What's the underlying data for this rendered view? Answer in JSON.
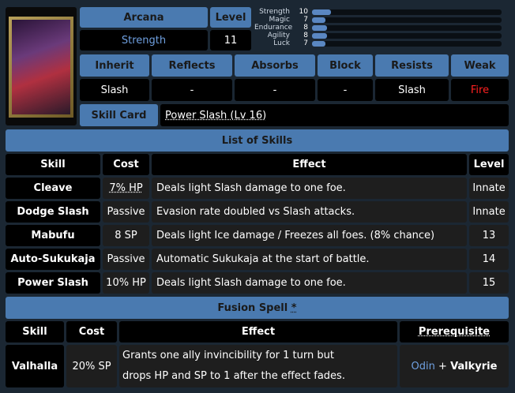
{
  "persona": {
    "arcana_label": "Arcana",
    "arcana_value": "Strength",
    "level_label": "Level",
    "level_value": "11"
  },
  "stats": [
    {
      "label": "Strength",
      "value": "10",
      "fill": 0.1
    },
    {
      "label": "Magic",
      "value": "7",
      "fill": 0.07
    },
    {
      "label": "Endurance",
      "value": "8",
      "fill": 0.08
    },
    {
      "label": "Agility",
      "value": "8",
      "fill": 0.08
    },
    {
      "label": "Luck",
      "value": "7",
      "fill": 0.07
    }
  ],
  "affinities": {
    "headers": [
      "Inherit",
      "Reflects",
      "Absorbs",
      "Block",
      "Resists",
      "Weak"
    ],
    "values": [
      "Slash",
      "-",
      "-",
      "-",
      "Slash",
      "Fire"
    ]
  },
  "skill_card": {
    "label": "Skill Card",
    "value": "Power Slash (Lv 16)"
  },
  "skills": {
    "title": "List of Skills",
    "headers": [
      "Skill",
      "Cost",
      "Effect",
      "Level"
    ],
    "rows": [
      {
        "skill": "Cleave",
        "cost": "7% HP",
        "effect": "Deals light Slash damage to one foe.",
        "level": "Innate"
      },
      {
        "skill": "Dodge Slash",
        "cost": "Passive",
        "effect": "Evasion rate doubled vs Slash attacks.",
        "level": "Innate"
      },
      {
        "skill": "Mabufu",
        "cost": "8 SP",
        "effect": "Deals light Ice damage / Freezes all foes. (8% chance)",
        "level": "13"
      },
      {
        "skill": "Auto-Sukukaja",
        "cost": "Passive",
        "effect": "Automatic Sukukaja at the start of battle.",
        "level": "14"
      },
      {
        "skill": "Power Slash",
        "cost": "10% HP",
        "effect": "Deals light Slash damage to one foe.",
        "level": "15"
      }
    ]
  },
  "fusion": {
    "title": "Fusion Spell",
    "title_mark": "*",
    "headers": [
      "Skill",
      "Cost",
      "Effect",
      "Prerequisite"
    ],
    "skill": "Valhalla",
    "cost": "20% SP",
    "effect_line1": "Grants one ally invincibility for 1 turn but",
    "effect_line2": "drops HP and SP to 1 after the effect fades.",
    "prereq_a": "Odin",
    "prereq_plus": "+",
    "prereq_b": "Valkyrie"
  },
  "colors": {
    "header_blue": "#4a7ab0",
    "weak_red": "#ff2020",
    "arcana_blue": "#6fa0e0",
    "bar_fill": "#5a87c2"
  }
}
